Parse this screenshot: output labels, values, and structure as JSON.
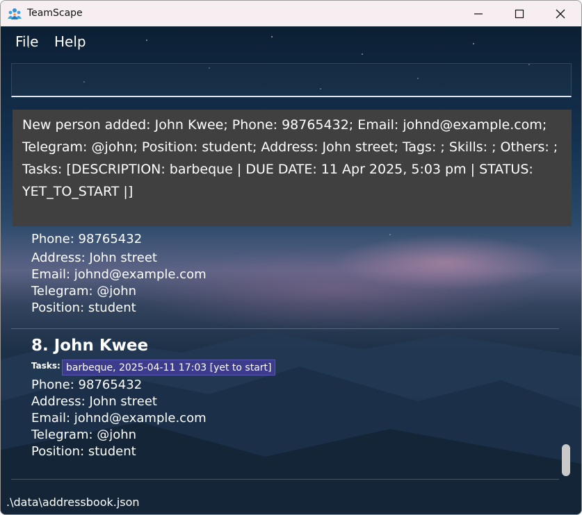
{
  "window": {
    "title": "TeamScape",
    "icon": "team-people-icon",
    "controls": [
      "minimize-icon",
      "maximize-icon",
      "close-icon"
    ]
  },
  "menu": {
    "file": "File",
    "help": "Help"
  },
  "command": {
    "value": ""
  },
  "result": {
    "line1": "New person added: John Kwee; Phone: 98765432; Email: johnd@example.com;",
    "line2": "Telegram: @john; Position: student; Address: John street; Tags: ; Skills: ; Others: ;",
    "line3": "Tasks: [DESCRIPTION: barbeque | DUE DATE: 11 Apr 2025, 5:03 pm | STATUS:",
    "line4": "YET_TO_START |]"
  },
  "cards": [
    {
      "phone": "Phone: 98765432",
      "address": "Address: John street",
      "email": "Email: johnd@example.com",
      "telegram": "Telegram: @john",
      "position": "Position: student"
    },
    {
      "name": "8. John Kwee",
      "tasks_label": "Tasks:",
      "task": "barbeque, 2025-04-11 17:03 [yet to start]",
      "phone": "Phone: 98765432",
      "address": "Address: John street",
      "email": "Email: johnd@example.com",
      "telegram": "Telegram: @john",
      "position": "Position: student"
    }
  ],
  "status": {
    "path": ".\\data\\addressbook.json"
  },
  "colors": {
    "result_bg": "#404040",
    "task_chip": "#3d3b8c",
    "titlebar": "#f6eef1"
  }
}
